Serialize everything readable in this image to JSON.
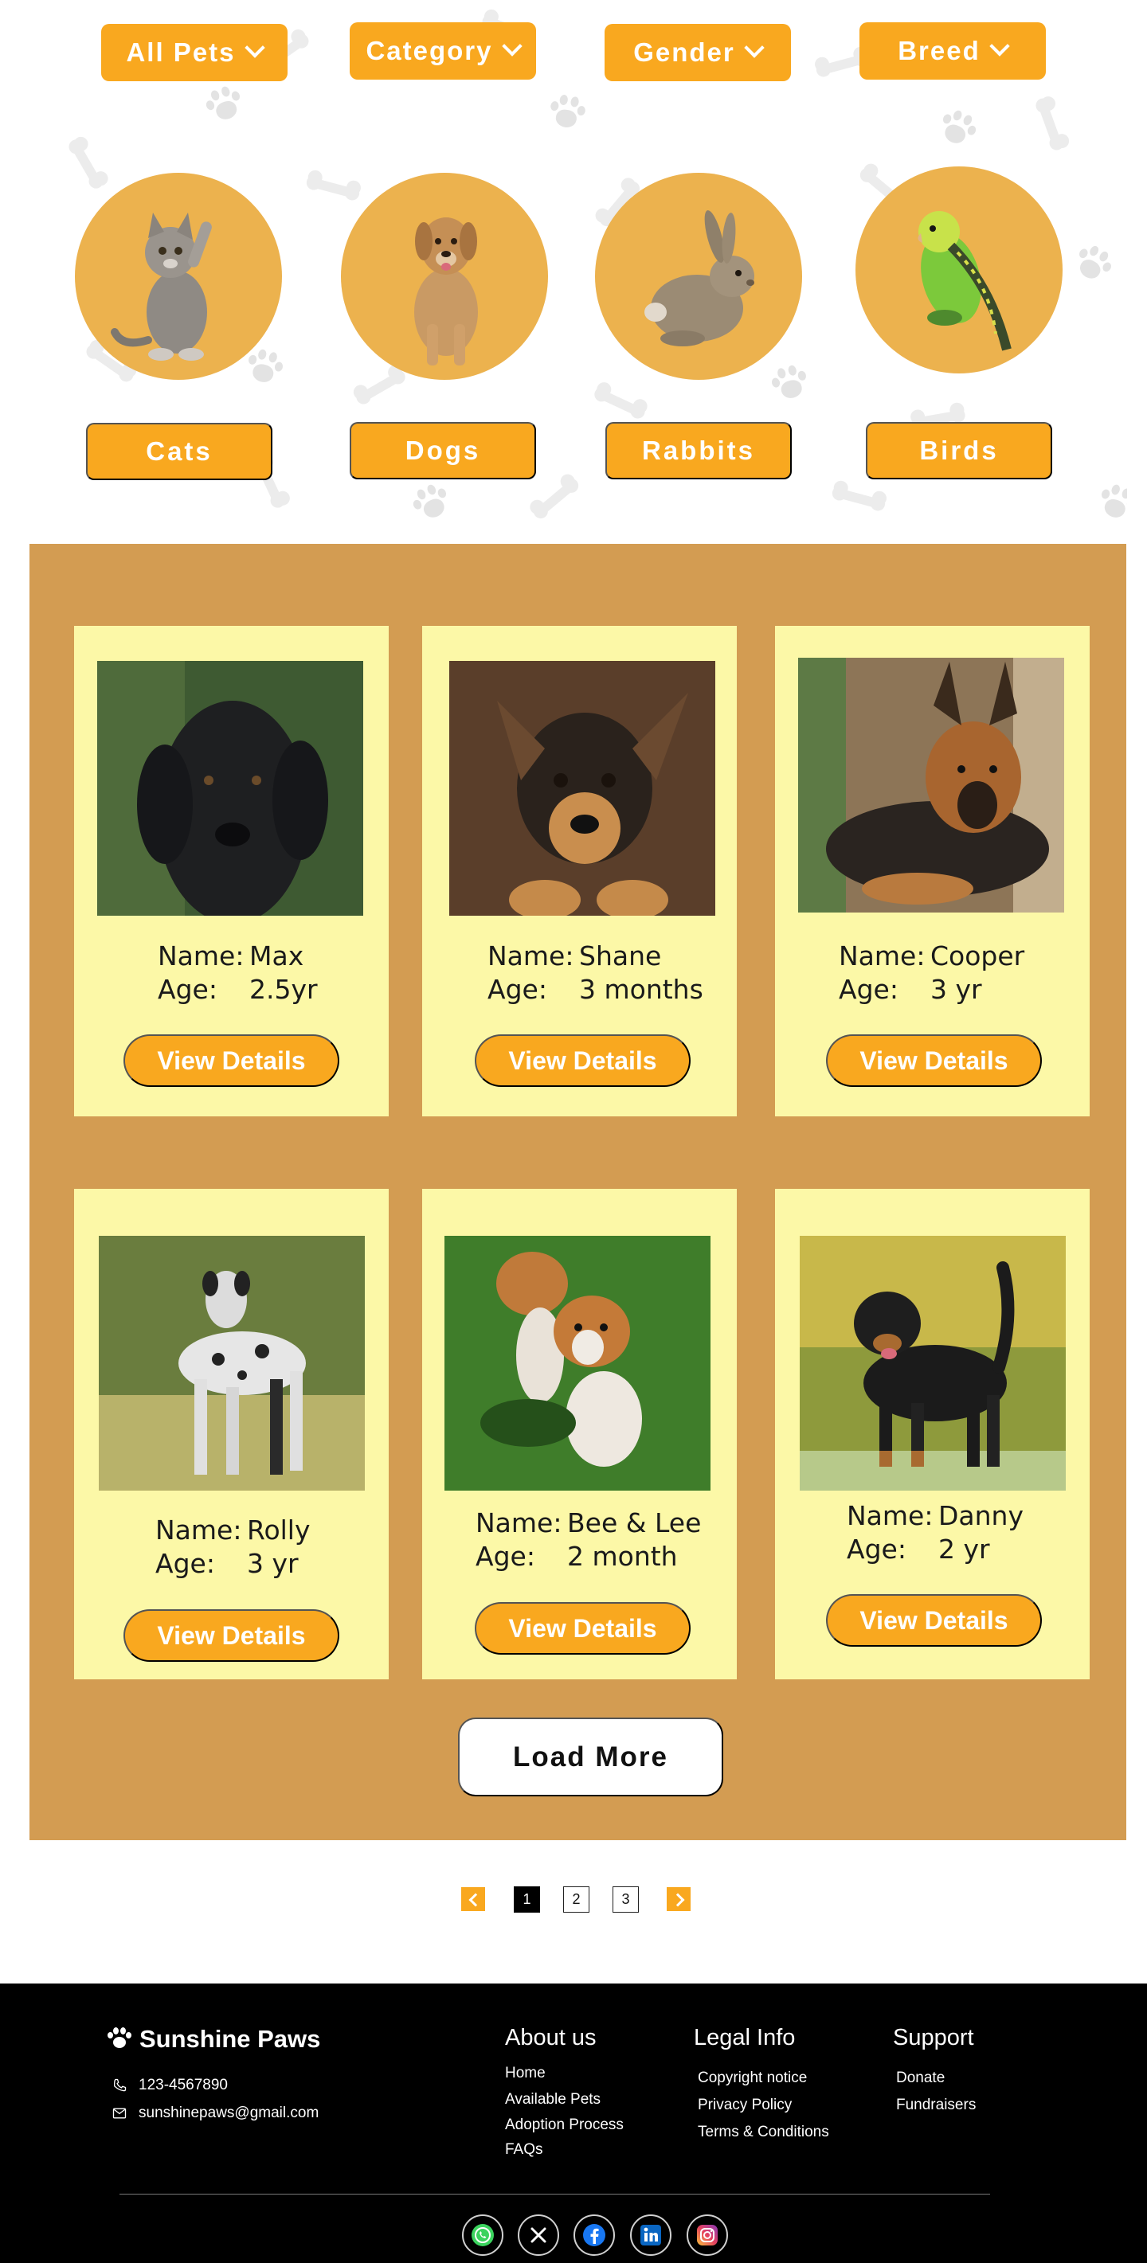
{
  "filters": [
    {
      "label": "All Pets"
    },
    {
      "label": "Category"
    },
    {
      "label": "Gender"
    },
    {
      "label": "Breed"
    }
  ],
  "categories": [
    {
      "label": "Cats"
    },
    {
      "label": "Dogs"
    },
    {
      "label": "Rabbits"
    },
    {
      "label": "Birds"
    }
  ],
  "pet_field_labels": {
    "name": "Name:",
    "age": "Age:"
  },
  "pets": [
    {
      "name": "Max",
      "age": "2.5yr",
      "button": "View Details"
    },
    {
      "name": "Shane",
      "age": "3 months",
      "button": "View Details"
    },
    {
      "name": "Cooper",
      "age": "3 yr",
      "button": "View Details"
    },
    {
      "name": "Rolly",
      "age": "3 yr",
      "button": "View Details"
    },
    {
      "name": "Bee & Lee",
      "age": "2 month",
      "button": "View Details"
    },
    {
      "name": "Danny",
      "age": "2 yr",
      "button": "View Details"
    }
  ],
  "load_more": "Load More",
  "pagination": {
    "pages": [
      "1",
      "2",
      "3"
    ],
    "current": "1"
  },
  "footer": {
    "brand": "Sunshine Paws",
    "phone": "123-4567890",
    "email": "sunshinepaws@gmail.com",
    "columns": [
      {
        "title": "About us",
        "links": [
          "Home",
          "Available Pets",
          "Adoption Process",
          "FAQs"
        ]
      },
      {
        "title": "Legal Info",
        "links": [
          "Copyright notice",
          "Privacy Policy",
          "Terms & Conditions"
        ]
      },
      {
        "title": "Support",
        "links": [
          "Donate",
          "Fundraisers"
        ]
      }
    ],
    "social_icons": [
      "whatsapp-icon",
      "x-icon",
      "facebook-icon",
      "linkedin-icon",
      "instagram-icon"
    ]
  },
  "colors": {
    "accent": "#f9a81f",
    "circle": "#ecb24e",
    "section_bg": "#d39c52",
    "card_bg": "#fcf8a7",
    "footer_bg": "#000000"
  }
}
